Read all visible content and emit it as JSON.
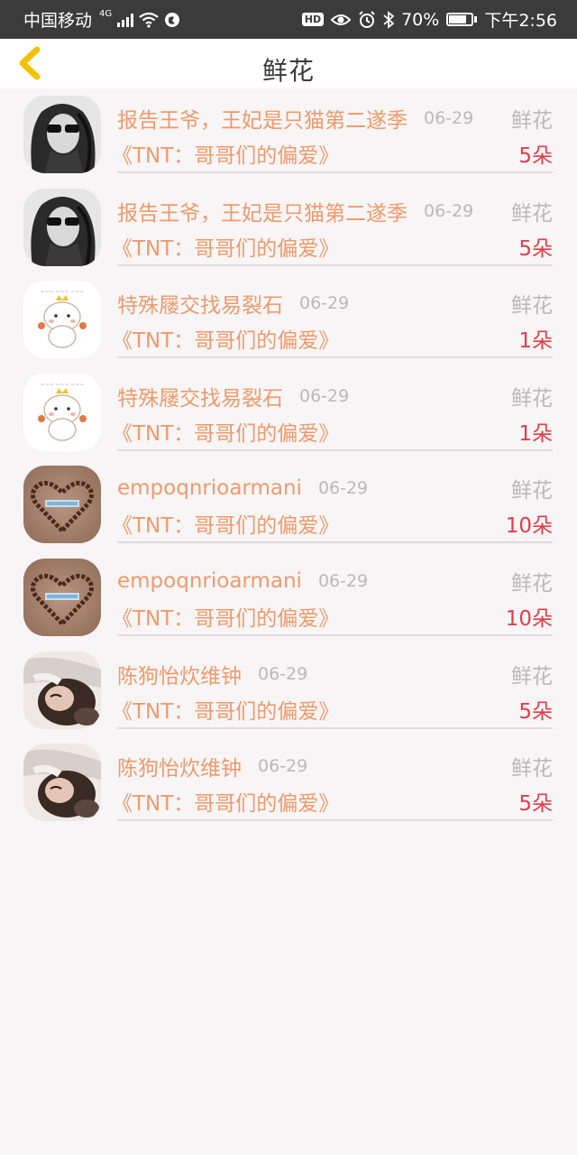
{
  "status_bar": {
    "carrier": "中国移动",
    "network": "4G",
    "battery": "70%",
    "time": "下午2:56"
  },
  "header": {
    "title": "鲜花",
    "back_icon": "chevron-left-icon"
  },
  "records": [
    {
      "user": "报告王爷，王妃是只猫第二遂季",
      "date": "06-29",
      "gift": "鲜花",
      "book": "《TNT：哥哥们的偏爱》",
      "count": "5朵",
      "avatar": "avatar-girl-sunglasses"
    },
    {
      "user": "报告王爷，王妃是只猫第二遂季",
      "date": "06-29",
      "gift": "鲜花",
      "book": "《TNT：哥哥们的偏爱》",
      "count": "5朵",
      "avatar": "avatar-girl-sunglasses"
    },
    {
      "user": "特殊屦交找易裂石",
      "date": "06-29",
      "gift": "鲜花",
      "book": "《TNT：哥哥们的偏爱》",
      "count": "1朵",
      "avatar": "avatar-cartoon-bun"
    },
    {
      "user": "特殊屦交找易裂石",
      "date": "06-29",
      "gift": "鲜花",
      "book": "《TNT：哥哥们的偏爱》",
      "count": "1朵",
      "avatar": "avatar-cartoon-bun"
    },
    {
      "user": "empoqnrioarmani",
      "date": "06-29",
      "gift": "鲜花",
      "book": "《TNT：哥哥们的偏爱》",
      "count": "10朵",
      "avatar": "avatar-bead-heart"
    },
    {
      "user": "empoqnrioarmani",
      "date": "06-29",
      "gift": "鲜花",
      "book": "《TNT：哥哥们的偏爱》",
      "count": "10朵",
      "avatar": "avatar-bead-heart"
    },
    {
      "user": "陈狗怡炊维钟",
      "date": "06-29",
      "gift": "鲜花",
      "book": "《TNT：哥哥们的偏爱》",
      "count": "5朵",
      "avatar": "avatar-girl-lying"
    },
    {
      "user": "陈狗怡炊维钟",
      "date": "06-29",
      "gift": "鲜花",
      "book": "《TNT：哥哥们的偏爱》",
      "count": "5朵",
      "avatar": "avatar-girl-lying"
    }
  ],
  "colors": {
    "user_name": "#ee9a6c",
    "book_title": "#ee9a6c",
    "count": "#e23d47",
    "meta": "#b9b9b9",
    "back_icon": "#f2c200"
  }
}
